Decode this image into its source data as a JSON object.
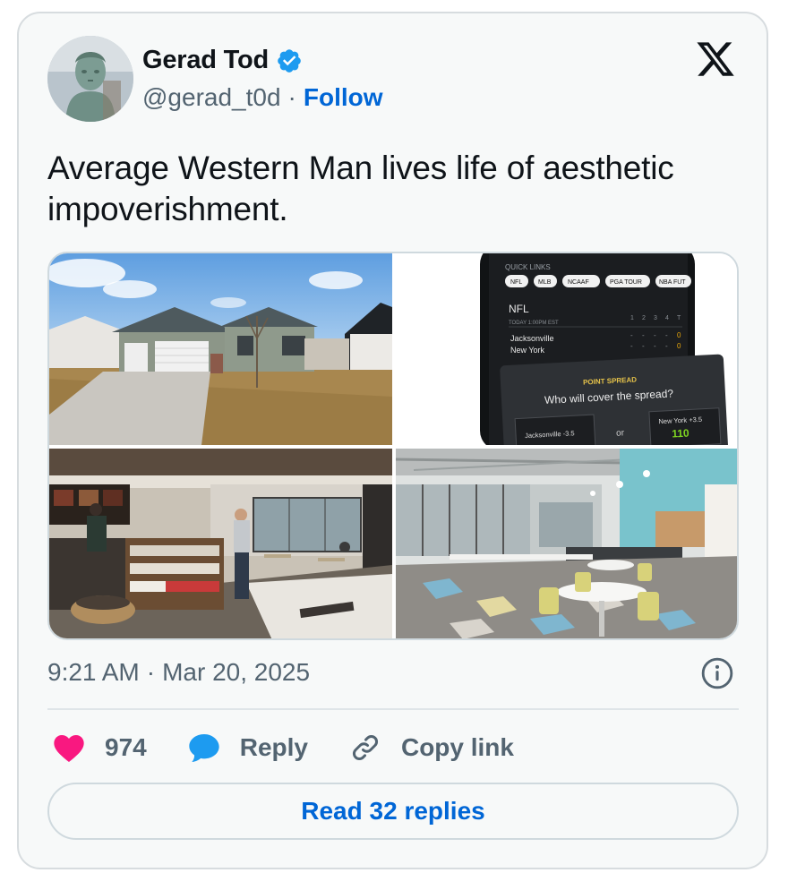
{
  "author": {
    "name": "Gerad Tod",
    "handle": "@gerad_t0d",
    "separator": "·",
    "follow_label": "Follow",
    "avatar_icon": "statue-avatar",
    "verified_icon": "verified-badge-icon"
  },
  "brand_icon": "x-logo-icon",
  "tweet": {
    "text": "Average Western Man lives life of aesthetic impoverishment."
  },
  "media": {
    "images": [
      {
        "name": "suburban-house-photo"
      },
      {
        "name": "sports-betting-app-photo",
        "quick_links_label": "QUICK LINKS",
        "chips": [
          "NFL",
          "MLB",
          "NCAAF",
          "PGA TOUR",
          "NBA FUT"
        ],
        "league": "NFL",
        "game_time": "TODAY 1:00PM EST",
        "quarters": [
          "1",
          "2",
          "3",
          "4",
          "T"
        ],
        "team1": "Jacksonville",
        "team2": "New York",
        "team1_scores": [
          "-",
          "-",
          "-",
          "-",
          "0"
        ],
        "team2_scores": [
          "-",
          "-",
          "-",
          "-",
          "0"
        ],
        "spread_title": "POINT SPREAD",
        "spread_question": "Who will cover the spread?",
        "option1": "Jacksonville -3.5",
        "or_label": "or",
        "option2": "New York +3.5",
        "option2_value": "110"
      },
      {
        "name": "starbucks-interior-photo"
      },
      {
        "name": "office-cafeteria-photo"
      }
    ]
  },
  "meta": {
    "time": "9:21 AM",
    "separator": "·",
    "date": "Mar 20, 2025"
  },
  "actions": {
    "like_count": "974",
    "reply_label": "Reply",
    "copy_label": "Copy link"
  },
  "read_replies_label": "Read 32 replies",
  "colors": {
    "like": "#f91880",
    "reply": "#1d9bf0",
    "link": "#0066d6",
    "verified": "#1d9bf0",
    "muted": "#536471"
  }
}
